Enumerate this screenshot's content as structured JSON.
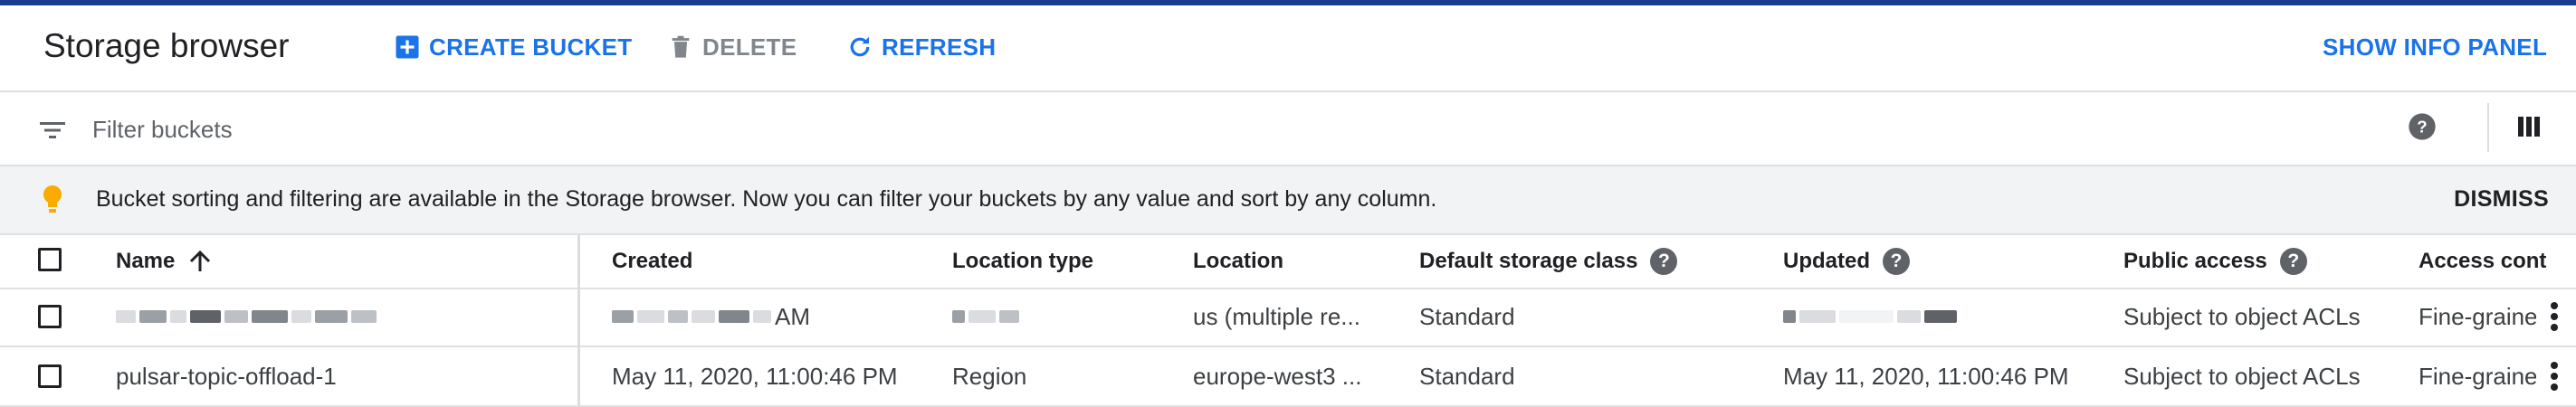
{
  "header": {
    "title": "Storage browser",
    "create_bucket": "CREATE BUCKET",
    "delete": "DELETE",
    "refresh": "REFRESH",
    "show_info_panel": "SHOW INFO PANEL"
  },
  "filter": {
    "placeholder": "Filter buckets"
  },
  "banner": {
    "text": "Bucket sorting and filtering are available in the Storage browser. Now you can filter your buckets by any value and sort by any column.",
    "dismiss": "DISMISS"
  },
  "table": {
    "columns": {
      "name": "Name",
      "created": "Created",
      "location_type": "Location type",
      "location": "Location",
      "default_storage_class": "Default storage class",
      "updated": "Updated",
      "public_access": "Public access",
      "access_control": "Access cont"
    },
    "rows": [
      {
        "name": "",
        "created": "AM",
        "location_type": "",
        "location": "us (multiple re...",
        "storage_class": "Standard",
        "updated": "",
        "public_access": "Subject to object ACLs",
        "access_control": "Fine-graine"
      },
      {
        "name": "pulsar-topic-offload-1",
        "created": "May 11, 2020, 11:00:46 PM",
        "location_type": "Region",
        "location": "europe-west3 ...",
        "storage_class": "Standard",
        "updated": "May 11, 2020, 11:00:46 PM",
        "public_access": "Subject to object ACLs",
        "access_control": "Fine-graine"
      }
    ]
  },
  "colors": {
    "accent": "#1a73e8",
    "top_line": "#1a3b8f",
    "disabled": "#80868b",
    "bulb": "#f9ab00",
    "banner_bg": "#f1f3f4"
  }
}
